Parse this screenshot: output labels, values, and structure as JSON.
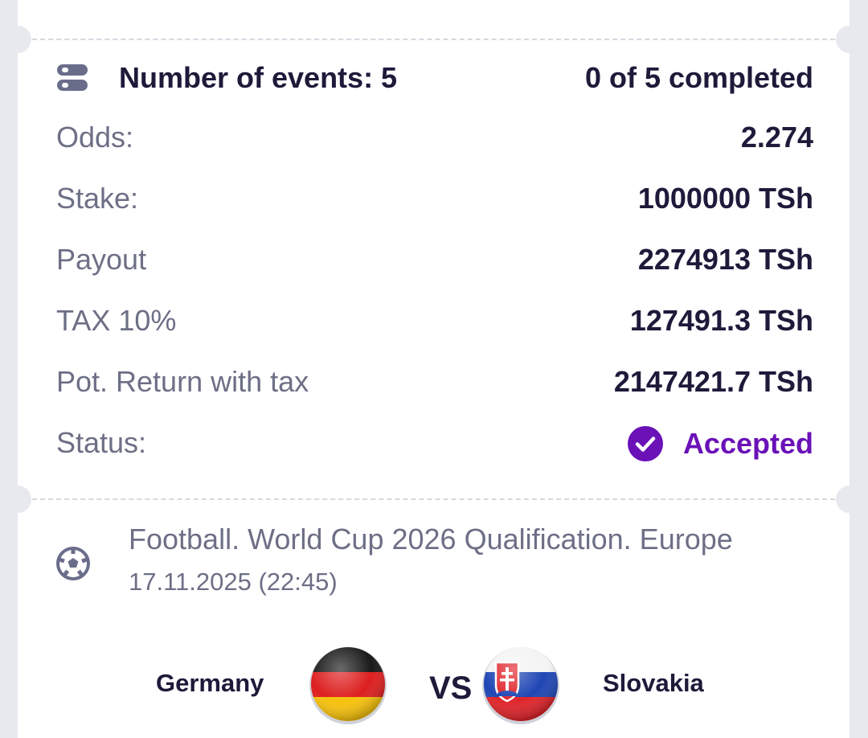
{
  "summary": {
    "events_label": "Number of events: 5",
    "completed_label": "0 of 5 completed"
  },
  "rows": {
    "odds": {
      "label": "Odds:",
      "value": "2.274"
    },
    "stake": {
      "label": "Stake:",
      "value": "1000000 TSh"
    },
    "payout": {
      "label": "Payout",
      "value": "2274913 TSh"
    },
    "tax": {
      "label": "TAX 10%",
      "value": "127491.3 TSh"
    },
    "pot_return": {
      "label": "Pot. Return with tax",
      "value": "2147421.7 TSh"
    },
    "status": {
      "label": "Status:",
      "value": "Accepted"
    }
  },
  "event": {
    "league": "Football. World Cup 2026 Qualification. Europe",
    "datetime": "17.11.2025 (22:45)",
    "home_team": "Germany",
    "vs": "VS",
    "away_team": "Slovakia"
  },
  "icons": {
    "events": "events-list-icon",
    "status": "check-circle-icon",
    "sport": "football-icon",
    "home_flag": "germany-flag-icon",
    "away_flag": "slovakia-flag-icon"
  },
  "colors": {
    "accent": "#6a11b8",
    "primary_text": "#1d1a3a",
    "secondary_text": "#6d6f86",
    "background": "#e7e9ef"
  }
}
